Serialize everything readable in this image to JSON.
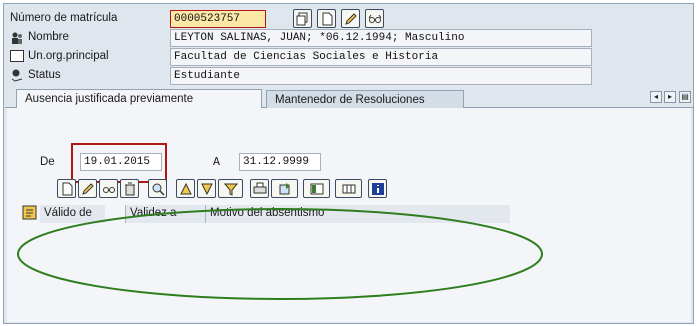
{
  "header": {
    "matricula_label": "Número de matrícula",
    "matricula_value": "0000523757",
    "nombre_label": "Nombre",
    "nombre_value": "LEYTON SALINAS, JUAN; *06.12.1994; Masculino",
    "unorg_label": "Un.org.principal",
    "unorg_value": "Facultad de Ciencias Sociales e Historia",
    "status_label": "Status",
    "status_value": "Estudiante"
  },
  "tabs": [
    {
      "label": "Ausencia justificada previamente",
      "active": true
    },
    {
      "label": "Mantenedor de Resoluciones",
      "active": false
    }
  ],
  "dates": {
    "de_label": "De",
    "de_value": "19.01.2015",
    "a_label": "A",
    "a_value": "31.12.9999"
  },
  "table": {
    "columns": [
      "Válido de",
      "Validez a",
      "Motivo del absentismo"
    ]
  },
  "colors": {
    "annotation_red": "#b01818",
    "annotation_green": "#2e7d1e",
    "frame_bg": "#dfe6ee"
  },
  "icons": {
    "matricula_toolbar": [
      "copy-icon",
      "new-page-icon",
      "edit-pencil-icon",
      "display-glasses-icon"
    ],
    "table_toolbar": [
      "create-icon",
      "change-icon",
      "display-icon",
      "delete-icon",
      "details-icon",
      "sort-ascending-icon",
      "sort-descending-icon",
      "filter-icon",
      "print-icon",
      "export-icon",
      "layout-icon",
      "columns-icon",
      "info-icon"
    ],
    "nav": [
      "scroll-left-icon",
      "scroll-right-icon",
      "tab-list-icon"
    ]
  }
}
